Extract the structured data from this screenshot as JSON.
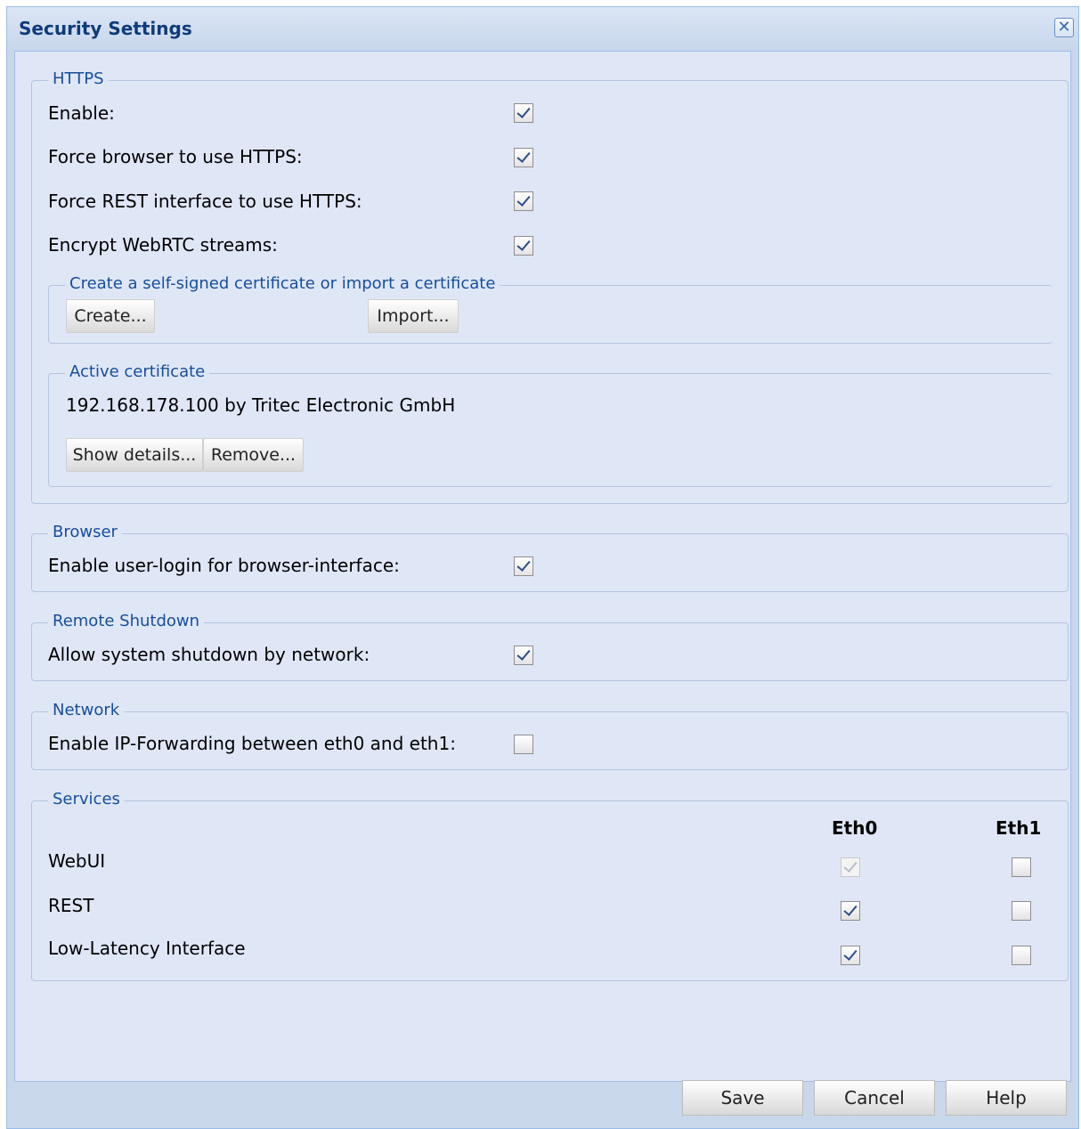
{
  "window": {
    "title": "Security Settings"
  },
  "https": {
    "legend": "HTTPS",
    "rows": [
      {
        "label": "Enable:",
        "checked": true
      },
      {
        "label": "Force browser to use HTTPS:",
        "checked": true
      },
      {
        "label": "Force REST interface to use HTTPS:",
        "checked": true
      },
      {
        "label": "Encrypt WebRTC streams:",
        "checked": true
      }
    ],
    "certificate_group": {
      "legend": "Create a self-signed certificate or import a certificate",
      "create_label": "Create...",
      "import_label": "Import..."
    },
    "active_certificate": {
      "legend": "Active certificate",
      "value": "192.168.178.100 by Tritec Electronic GmbH",
      "show_details_label": "Show details...",
      "remove_label": "Remove..."
    }
  },
  "browser": {
    "legend": "Browser",
    "label": "Enable user-login for browser-interface:",
    "checked": true
  },
  "remote_shutdown": {
    "legend": "Remote Shutdown",
    "label": "Allow system shutdown by network:",
    "checked": true
  },
  "network": {
    "legend": "Network",
    "label": "Enable IP-Forwarding between eth0 and eth1:",
    "checked": false
  },
  "services": {
    "legend": "Services",
    "columns": [
      "Eth0",
      "Eth1"
    ],
    "rows": [
      {
        "label": "WebUI",
        "eth0": true,
        "eth0_disabled": true,
        "eth1": false
      },
      {
        "label": "REST",
        "eth0": true,
        "eth1": false
      },
      {
        "label": "Low-Latency Interface",
        "eth0": true,
        "eth1": false
      }
    ]
  },
  "footer": {
    "save_label": "Save",
    "cancel_label": "Cancel",
    "help_label": "Help"
  },
  "colors": {
    "accent": "#0f3b7a",
    "legend": "#174d9c",
    "panel": "#dfe7f7"
  }
}
